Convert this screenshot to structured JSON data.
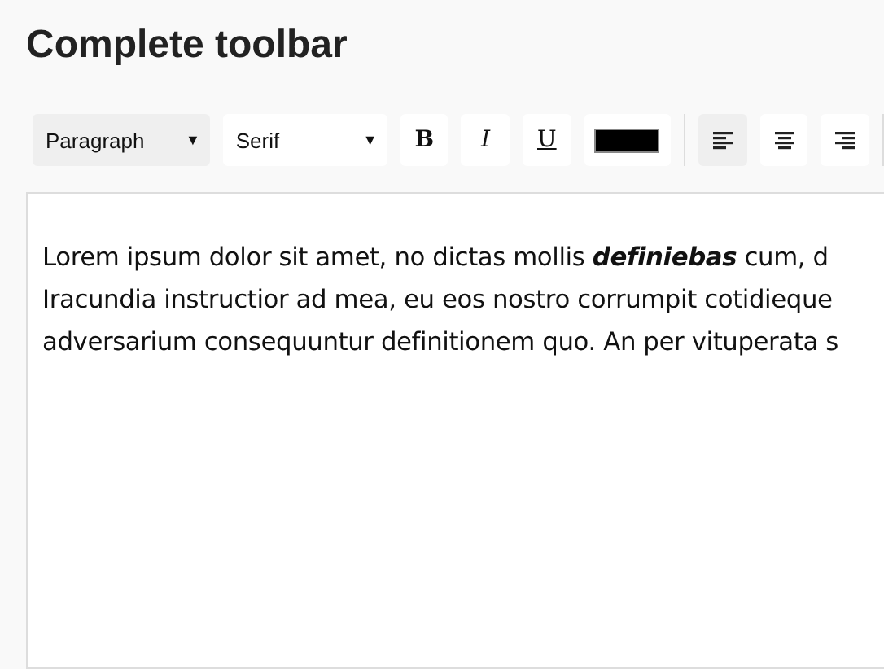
{
  "title": "Complete toolbar",
  "toolbar": {
    "block_format": "Paragraph",
    "font": "Serif",
    "caret": "▼",
    "format_buttons": [
      {
        "kind": "bold",
        "label": "B"
      },
      {
        "kind": "italic",
        "label": "I"
      },
      {
        "kind": "underline",
        "label": "U"
      }
    ],
    "color_swatch": {
      "color": "#000000"
    },
    "align_buttons": [
      {
        "kind": "left",
        "selected": true
      },
      {
        "kind": "center",
        "selected": false
      },
      {
        "kind": "right",
        "selected": false
      }
    ]
  },
  "editor": {
    "lines": [
      "Lorem ipsum dolor sit amet, no dictas mollis **definiebas** cum, d",
      "Iracundia instructior ad mea, eu eos nostro corrumpit cotidieque",
      "adversarium consequuntur definitionem quo. An per vituperata s"
    ]
  }
}
